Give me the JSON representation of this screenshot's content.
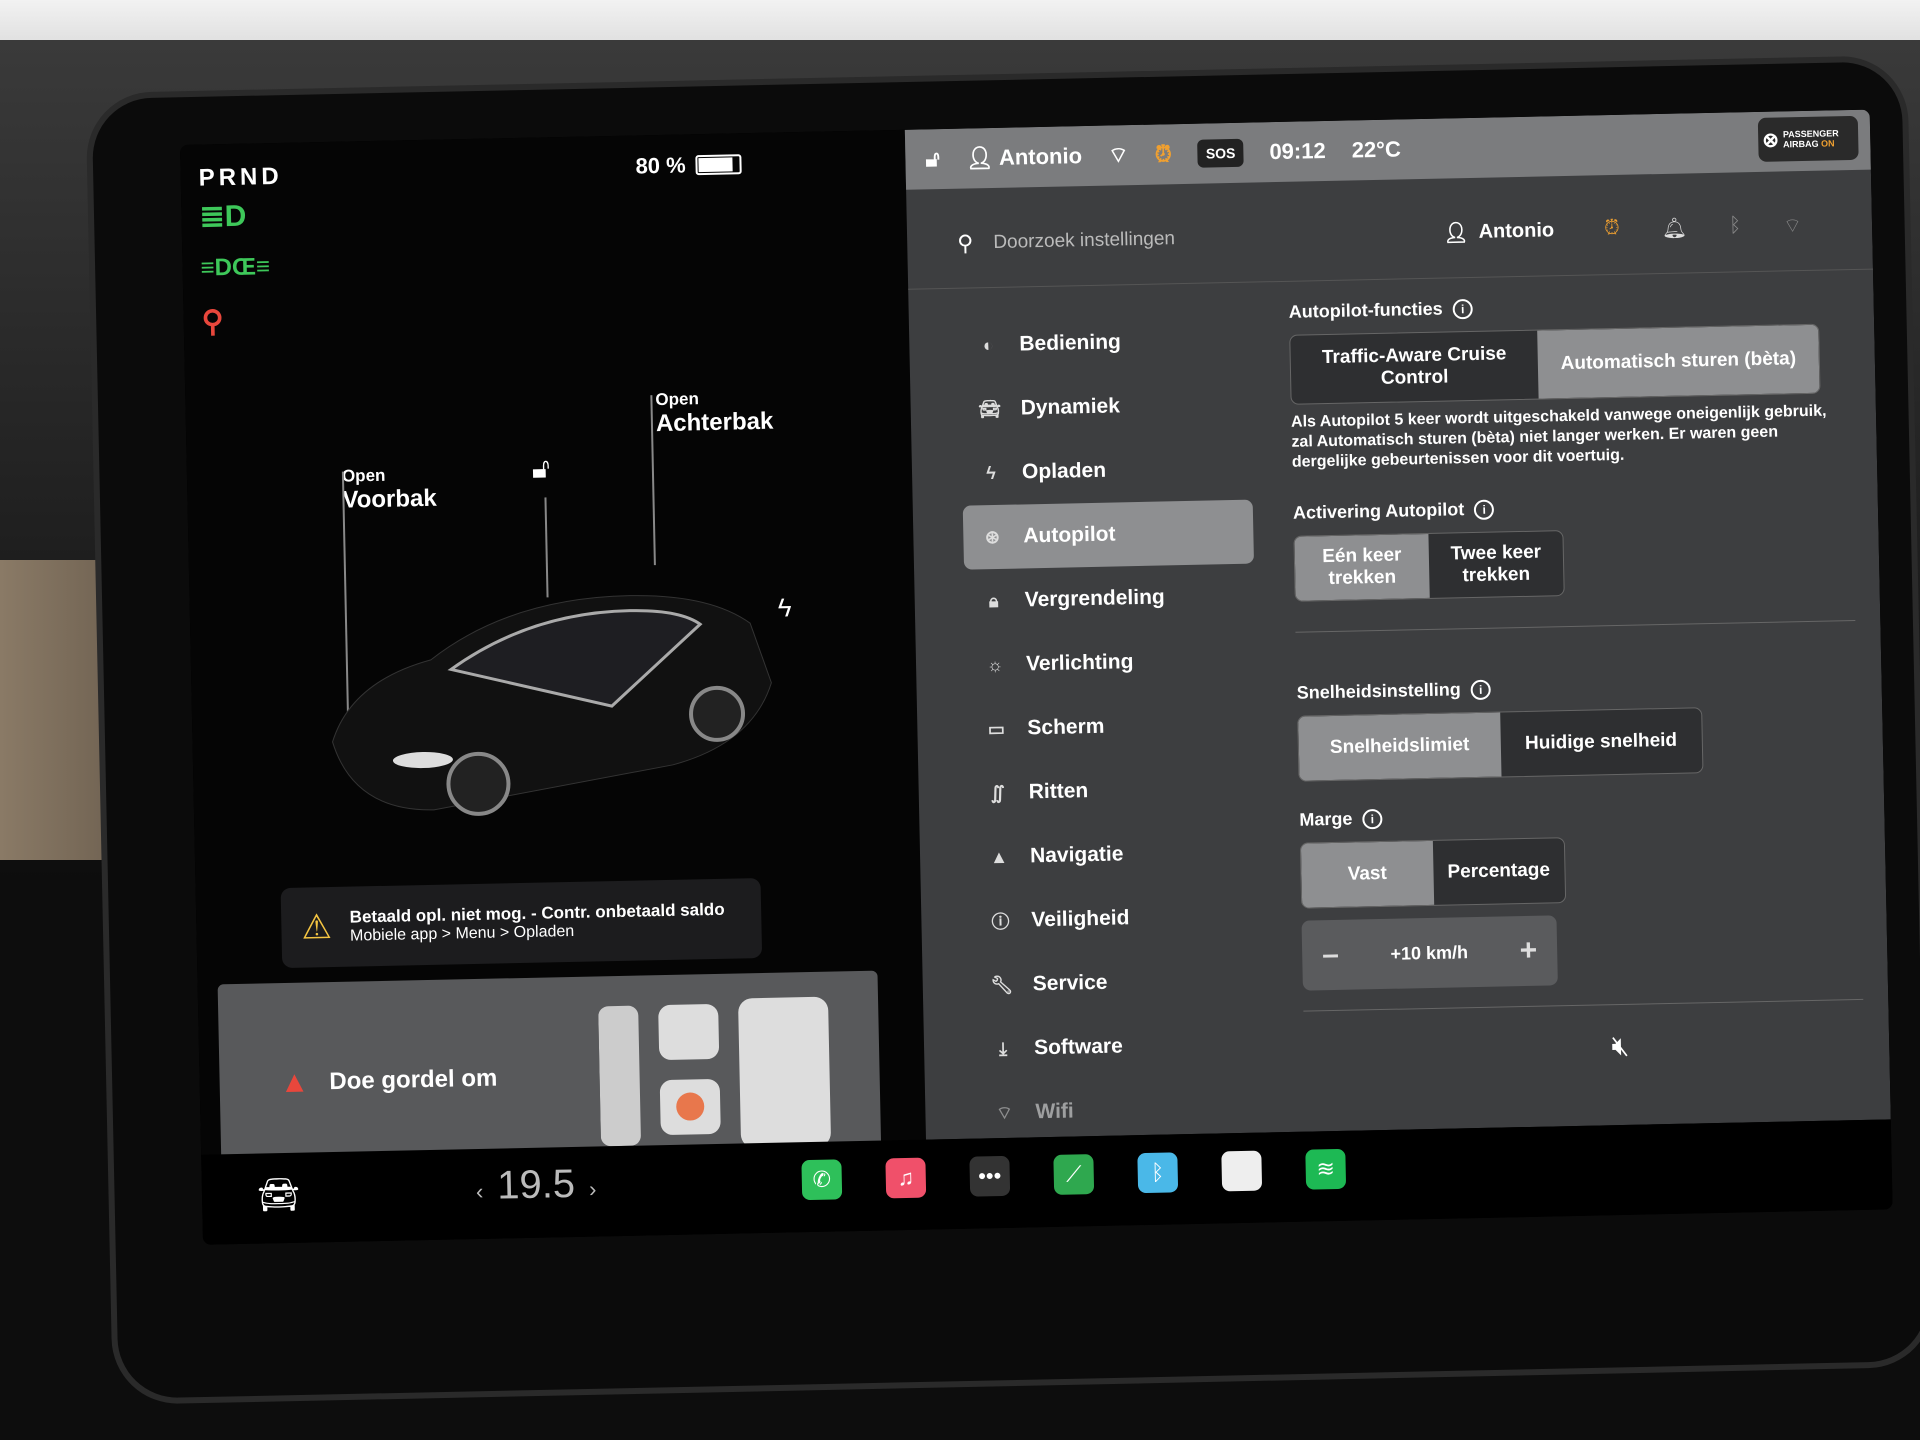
{
  "gear": "PRND",
  "battery": {
    "percent_label": "80 %",
    "level": 0.8
  },
  "indicators": [
    {
      "icon": "headlight-icon",
      "color": "#3ec85a"
    },
    {
      "icon": "parking-lights-icon",
      "color": "#3ec85a"
    },
    {
      "icon": "seatbelt-warning-icon",
      "color": "#e8473c"
    }
  ],
  "car_view": {
    "frunk": {
      "state": "Open",
      "label": "Voorbak"
    },
    "trunk": {
      "state": "Open",
      "label": "Achterbak"
    },
    "lock_icon": "unlock-icon",
    "charge_icon": "lightning-icon"
  },
  "alert": {
    "line1": "Betaald opl. niet mog. - Contr. onbetaald saldo",
    "line2": "Mobiele app > Menu > Opladen"
  },
  "seatbelt_alert": "Doe gordel om",
  "statusbar": {
    "user": "Antonio",
    "time": "09:12",
    "temperature": "22°C",
    "sos": "SOS",
    "airbag_line1": "PASSENGER",
    "airbag_line2": "AIRBAG",
    "airbag_state": "ON"
  },
  "settings": {
    "search_placeholder": "Doorzoek instellingen",
    "user": "Antonio",
    "menu": [
      {
        "label": "Bediening",
        "icon": "toggle-icon"
      },
      {
        "label": "Dynamiek",
        "icon": "car-icon"
      },
      {
        "label": "Opladen",
        "icon": "lightning-icon"
      },
      {
        "label": "Autopilot",
        "icon": "steering-wheel-icon",
        "active": true
      },
      {
        "label": "Vergrendeling",
        "icon": "lock-icon"
      },
      {
        "label": "Verlichting",
        "icon": "sun-icon"
      },
      {
        "label": "Scherm",
        "icon": "display-icon"
      },
      {
        "label": "Ritten",
        "icon": "trips-icon"
      },
      {
        "label": "Navigatie",
        "icon": "navigation-icon"
      },
      {
        "label": "Veiligheid",
        "icon": "safety-icon"
      },
      {
        "label": "Service",
        "icon": "wrench-icon"
      },
      {
        "label": "Software",
        "icon": "download-icon"
      },
      {
        "label": "Wifi",
        "icon": "wifi-icon"
      }
    ],
    "autopilot_features": {
      "title": "Autopilot-functies",
      "options": [
        "Traffic-Aware Cruise Control",
        "Automatisch sturen (bèta)"
      ],
      "selected": 1,
      "description": "Als Autopilot 5 keer wordt uitgeschakeld vanwege oneigenlijk gebruik, zal Automatisch sturen (bèta) niet langer werken. Er waren geen dergelijke gebeurtenissen voor dit voertuig."
    },
    "activation": {
      "title": "Activering Autopilot",
      "options": [
        "Eén keer trekken",
        "Twee keer trekken"
      ],
      "selected": 0
    },
    "speed_setting": {
      "title": "Snelheidsinstelling",
      "options": [
        "Snelheidslimiet",
        "Huidige snelheid"
      ],
      "selected": 0
    },
    "margin": {
      "title": "Marge",
      "options": [
        "Vast",
        "Percentage"
      ],
      "selected": 0,
      "value": "+10 km/h",
      "minus": "–",
      "plus": "+"
    }
  },
  "dock": {
    "temperature": "19.5",
    "left_arrow": "‹",
    "right_arrow": "›",
    "apps": [
      {
        "name": "phone",
        "color": "#2ec05a",
        "glyph": "✆"
      },
      {
        "name": "music",
        "color": "#f0506a",
        "glyph": "♫"
      },
      {
        "name": "more",
        "color": "#333",
        "glyph": "•••"
      },
      {
        "name": "energy",
        "color": "#2fa84f",
        "glyph": "⟋"
      },
      {
        "name": "bluetooth",
        "color": "#4ab8e8",
        "glyph": "ᛒ"
      },
      {
        "name": "notes",
        "color": "#eee",
        "glyph": ""
      },
      {
        "name": "spotify",
        "color": "#1db954",
        "glyph": "≋"
      }
    ],
    "volume_icon": "mute-icon"
  }
}
